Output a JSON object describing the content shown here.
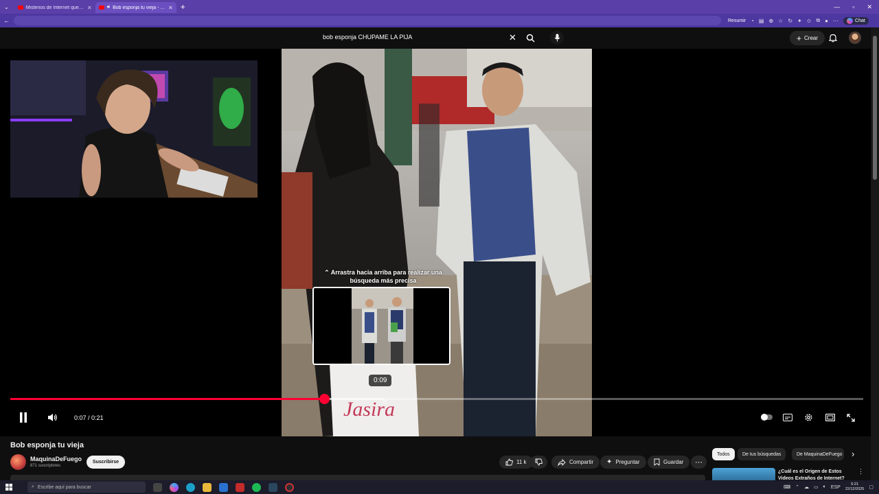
{
  "browser": {
    "tabs": [
      {
        "title": "Misterios de Internet que Duraron",
        "active": false
      },
      {
        "title": "Bob esponja tu vieja - YouTube",
        "active": true
      }
    ],
    "summarize_label": "Resumir",
    "chat_label": "Chat"
  },
  "header": {
    "search_query": "bob esponja CHUPAME LA PIJA",
    "create_label": "Crear"
  },
  "player": {
    "hint_text": "⌃ Arrastra hacia arriba para realizar una búsqueda más precisa",
    "preview_time": "0:09",
    "time_display": "0:07 / 0:21",
    "played_fraction": 0.368,
    "hover_fraction": 0.438,
    "shirt_text": "Jasira",
    "state": "playing"
  },
  "video": {
    "title": "Bob esponja tu vieja",
    "channel": "MaquinaDeFuego",
    "subscribers": "871 suscriptores",
    "subscribe_label": "Suscribirse",
    "likes": "11 k",
    "share_label": "Compartir",
    "ask_label": "Preguntar",
    "save_label": "Guardar"
  },
  "recommendations": {
    "chips": [
      "Todos",
      "De tus búsquedas",
      "De MaquinaDeFuego"
    ],
    "first_title": "¿Cuál es el Origen de Estos Videos Extraños de Internet?"
  },
  "taskbar": {
    "search_placeholder": "Escribe aquí para buscar",
    "language": "ESP",
    "time": "5:21",
    "date": "22/12/2025"
  },
  "colors": {
    "accent": "#ff0033",
    "browser_frame": "#5b3fa8",
    "page_bg": "#0f0f0f"
  }
}
